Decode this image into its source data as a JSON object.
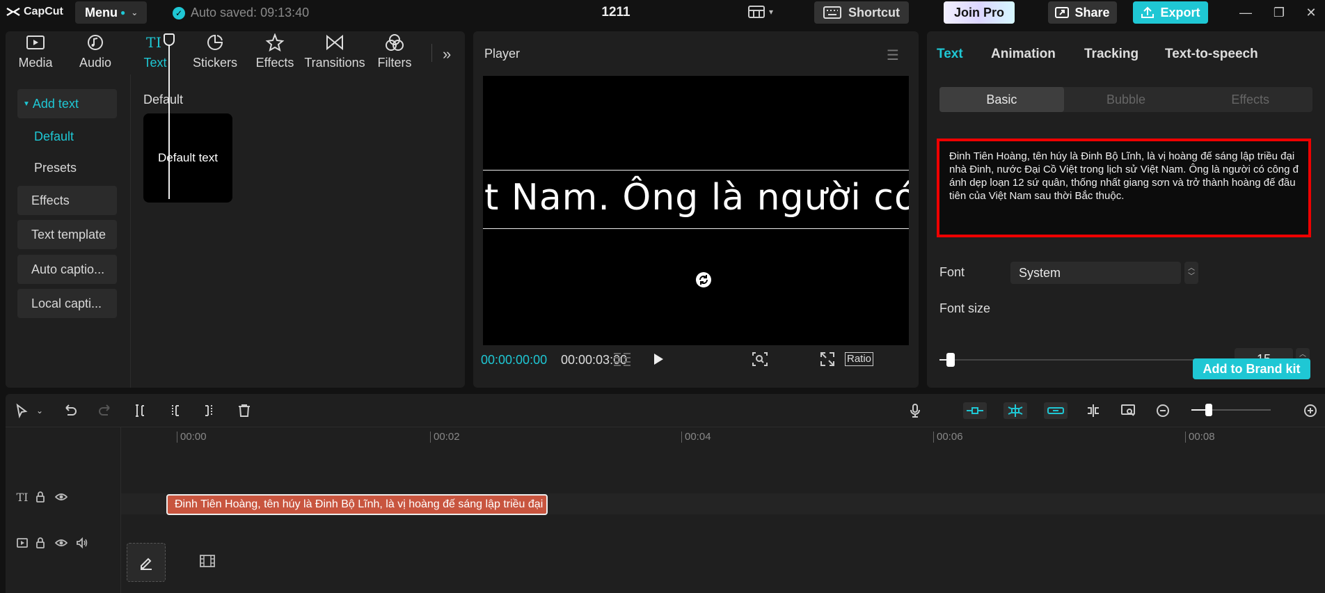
{
  "app": {
    "logo_text": "CapCut"
  },
  "topbar": {
    "menu_label": "Menu",
    "autosave": "Auto saved: 09:13:40",
    "project_title": "1211",
    "shortcut_label": "Shortcut",
    "joinpro_label": "Join Pro",
    "share_label": "Share",
    "export_label": "Export"
  },
  "media_tabs": [
    {
      "label": "Media",
      "icon": "media-icon"
    },
    {
      "label": "Audio",
      "icon": "audio-icon"
    },
    {
      "label": "Text",
      "icon": "text-icon"
    },
    {
      "label": "Stickers",
      "icon": "stickers-icon"
    },
    {
      "label": "Effects",
      "icon": "effects-icon"
    },
    {
      "label": "Transitions",
      "icon": "transitions-icon"
    },
    {
      "label": "Filters",
      "icon": "filters-icon"
    }
  ],
  "left_nav": {
    "add_text": "Add text",
    "default": "Default",
    "presets": "Presets",
    "effects": "Effects",
    "text_template": "Text template",
    "auto_captions": "Auto captio...",
    "local_captions": "Local capti..."
  },
  "text_content": {
    "section_title": "Default",
    "card_label": "Default text"
  },
  "player": {
    "title": "Player",
    "caption_preview": "t Nam. Ông là người có c",
    "timecode_current": "00:00:00:00",
    "timecode_total": "00:00:03:00",
    "ratio_label": "Ratio"
  },
  "right_panel": {
    "tabs": [
      "Text",
      "Animation",
      "Tracking",
      "Text-to-speech"
    ],
    "subtabs": [
      "Basic",
      "Bubble",
      "Effects"
    ],
    "text_value": "Đinh Tiên Hoàng, tên húy là Đinh Bộ Lĩnh, là vị hoàng đế sáng lập triều đại nhà Đinh, nước Đại Cồ Việt trong lịch sử Việt Nam. Ông là người có công đánh dẹp loạn 12 sứ quân, thống nhất giang sơn và trở thành hoàng đế đầu tiên của Việt Nam sau thời Bắc thuộc.",
    "font_label": "Font",
    "font_value": "System",
    "font_size_label": "Font size",
    "font_size_value": "15",
    "font_size_fraction": 0.04,
    "brand_kit_label": "Add to Brand kit"
  },
  "timeline": {
    "ruler_ticks": [
      "00:00",
      "00:02",
      "00:04",
      "00:06",
      "00:08"
    ],
    "clip_text": "Đinh Tiên Hoàng, tên húy là Đinh Bộ Lĩnh, là vị hoàng đế sáng lập triều đại nhà Đinh",
    "zoom_fraction": 0.22
  },
  "colors": {
    "accent": "#1fc7d4",
    "clip": "#c8553f",
    "highlight_border": "#e00000"
  }
}
